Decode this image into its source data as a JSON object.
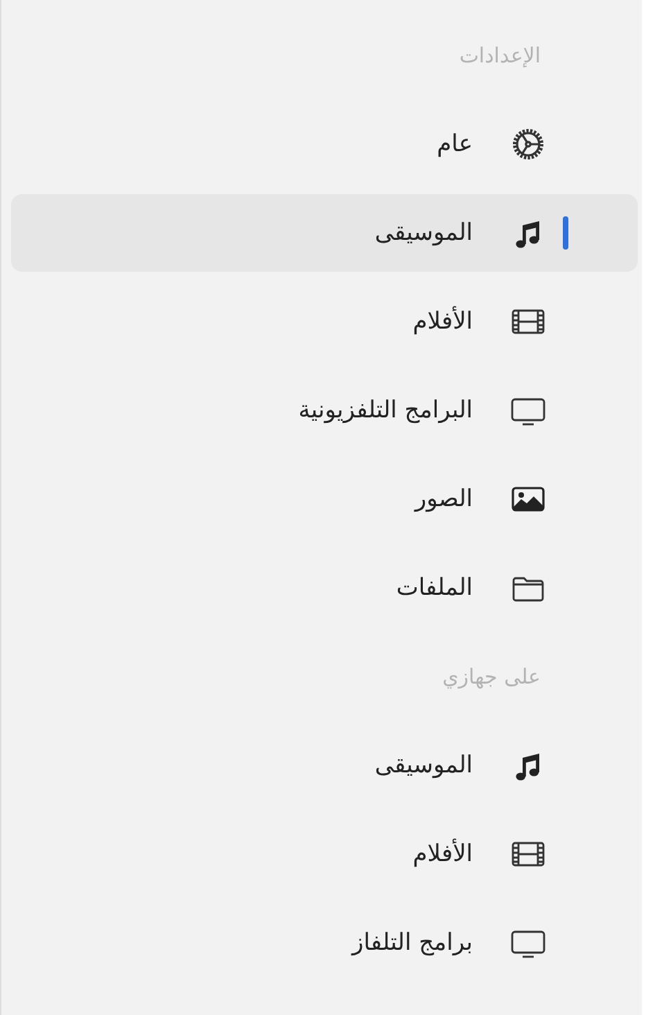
{
  "sections": [
    {
      "title": "الإعدادات",
      "items": [
        {
          "label": "عام",
          "kind": "gear",
          "selected": false
        },
        {
          "label": "الموسيقى",
          "kind": "music",
          "selected": true
        },
        {
          "label": "الأفلام",
          "kind": "film",
          "selected": false
        },
        {
          "label": "البرامج التلفزيونية",
          "kind": "tv",
          "selected": false
        },
        {
          "label": "الصور",
          "kind": "photo",
          "selected": false
        },
        {
          "label": "الملفات",
          "kind": "folder",
          "selected": false
        }
      ]
    },
    {
      "title": "على جهازي",
      "items": [
        {
          "label": "الموسيقى",
          "kind": "music",
          "selected": false
        },
        {
          "label": "الأفلام",
          "kind": "film",
          "selected": false
        },
        {
          "label": "برامج التلفاز",
          "kind": "tv",
          "selected": false
        }
      ]
    }
  ]
}
